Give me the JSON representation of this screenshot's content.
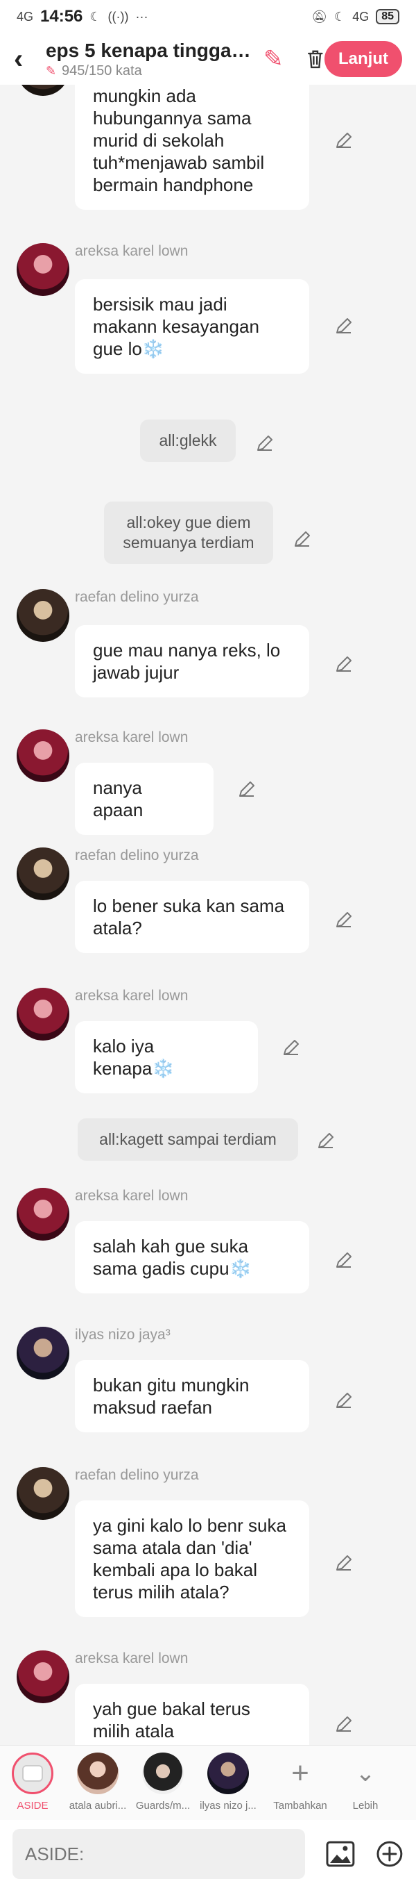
{
  "status": {
    "signal": "4G",
    "time": "14:56",
    "battery": "85",
    "network": "4G"
  },
  "header": {
    "title": "eps 5 kenapa tinggali...",
    "word_count": "945/150 kata",
    "continue_label": "Lanjut"
  },
  "chat": {
    "m0": "mungkin ada hubungannya sama murid di sekolah tuh*menjawab sambil bermain handphone",
    "m1": {
      "name": "areksa karel lown",
      "text": "bersisik mau jadi makann kesayangan gue lo",
      "emoji": "❄️"
    },
    "s1": "all:glekk",
    "s2": "all:okey gue diem semuanya terdiam",
    "m2": {
      "name": "raefan delino yurza",
      "text": "gue mau nanya reks, lo jawab jujur"
    },
    "m3": {
      "name": "areksa karel lown",
      "text": "nanya apaan"
    },
    "m4": {
      "name": "raefan delino yurza",
      "text": "lo bener suka kan sama atala?"
    },
    "m5": {
      "name": "areksa karel lown",
      "text": "kalo iya kenapa",
      "emoji": "❄️"
    },
    "s3": "all:kagett sampai terdiam",
    "m6": {
      "name": "areksa karel lown",
      "text": "salah kah gue suka sama gadis cupu",
      "emoji": "❄️"
    },
    "m7": {
      "name": "ilyas nizo jaya³",
      "text": "bukan gitu mungkin maksud raefan"
    },
    "m8": {
      "name": "raefan delino yurza",
      "text": "ya gini kalo lo benr suka sama atala dan 'dia' kembali apa lo bakal terus milih atala?"
    },
    "m9": {
      "name": "areksa karel lown",
      "text": "yah gue bakal terus milih atala"
    }
  },
  "charbar": {
    "aside": "ASIDE",
    "c1": "atala aubri...",
    "c2": "Guards/m...",
    "c3": "ilyas nizo j...",
    "add": "Tambahkan",
    "more": "Lebih"
  },
  "input": {
    "placeholder": "ASIDE:"
  },
  "colors": {
    "accent": "#f0506e",
    "background": "#f4f4f4"
  }
}
